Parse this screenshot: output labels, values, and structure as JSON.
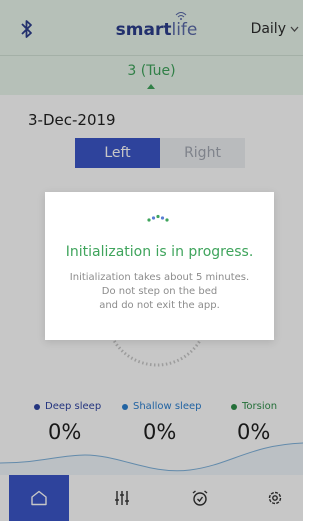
{
  "header": {
    "brand_smart": "smart",
    "brand_life": "life",
    "period": "Daily",
    "selected_day": "3 (Tue)"
  },
  "main": {
    "date": "3-Dec-2019",
    "side_left": "Left",
    "side_right": "Right"
  },
  "stats": [
    {
      "label": "Deep sleep",
      "value": "0%",
      "color": "#2f44a3"
    },
    {
      "label": "Shallow sleep",
      "value": "0%",
      "color": "#2b7fd0"
    },
    {
      "label": "Torsion",
      "value": "0%",
      "color": "#2f8f4a"
    }
  ],
  "modal": {
    "title": "Initialization is in progress.",
    "line1": "Initialization takes about 5 minutes.",
    "line2": "Do not step on the bed",
    "line3": "and do not exit the app."
  },
  "nav": {
    "items": [
      "home-icon",
      "sliders-icon",
      "alarm-icon",
      "settings-icon"
    ],
    "active": 0
  },
  "colors": {
    "accent": "#3b56c8",
    "green": "#3fa45c",
    "header_bg": "#e9f6ec"
  }
}
